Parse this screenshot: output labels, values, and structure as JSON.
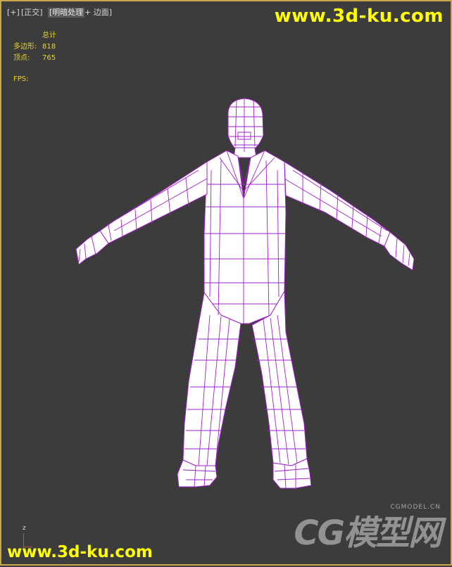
{
  "viewport": {
    "labels": [
      "[+]",
      "[正交]",
      "[明暗处理",
      "+ 边面]"
    ]
  },
  "stats": {
    "header": "总计",
    "rows": [
      {
        "label": "多边形:",
        "value": "818"
      },
      {
        "label": "顶点:",
        "value": "765"
      }
    ],
    "fps_label": "FPS:"
  },
  "watermarks": {
    "top": "www.3d-ku.com",
    "bottom": "www.3d-ku.com",
    "cg_big": "CG模型网",
    "cg_small": "CGMODEL.CN"
  },
  "axis": {
    "z_label": "z"
  },
  "colors": {
    "wire": "#a020c8",
    "fill": "#ffffff",
    "stats": "#e8d22a",
    "watermark": "#ffff00"
  }
}
